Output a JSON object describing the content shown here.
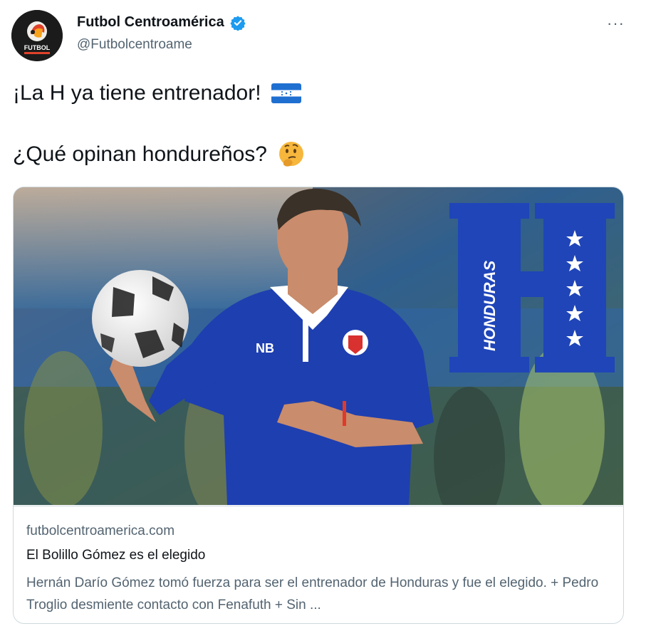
{
  "account": {
    "display_name": "Futbol Centroamérica",
    "handle": "@Futbolcentroame",
    "avatar_text": "FUTBOL"
  },
  "menu": {
    "more_label": "···"
  },
  "tweet": {
    "line1": "¡La H ya tiene entrenador!",
    "line2": "¿Qué opinan hondureños?",
    "flag_icon": "honduras-flag-icon",
    "emoji_icon": "thinking-face-icon"
  },
  "card": {
    "image_logo_text": "HONDURAS",
    "domain": "futbolcentroamerica.com",
    "title": "El Bolillo Gómez es el elegido",
    "description": "Hernán Darío Gómez tomó fuerza para ser el entrenador de Honduras y fue el elegido. + Pedro Troglio desmiente contacto con Fenafuth + Sin ..."
  },
  "colors": {
    "verified": "#1d9bf0",
    "secondary_text": "#536471",
    "border": "#cfd9de",
    "honduras_blue": "#1f45b8",
    "jersey_blue": "#1e3fb0"
  }
}
